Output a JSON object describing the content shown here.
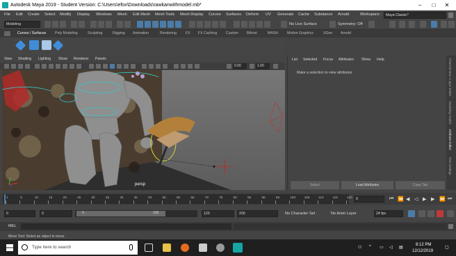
{
  "window": {
    "title": "Autodesk Maya 2019 - Student Version: C:\\Users\\efox\\Downloads\\rawkanwithmodel.mb*"
  },
  "menus": [
    "File",
    "Edit",
    "Create",
    "Select",
    "Modify",
    "Display",
    "Windows",
    "Mesh",
    "Edit Mesh",
    "Mesh Tools",
    "Mesh Display",
    "Curves",
    "Surfaces",
    "Deform",
    "UV",
    "Generate",
    "Cache",
    "Substance",
    "Arnold"
  ],
  "workspace": {
    "label": "Workspace :",
    "value": "Maya Classic*"
  },
  "status_line": {
    "mode": "Modeling",
    "live_surface": "No Live Surface",
    "symmetry": "Symmetry: Off"
  },
  "shelf_tabs": [
    "Curves / Surfaces",
    "Poly Modeling",
    "Sculpting",
    "Rigging",
    "Animation",
    "Rendering",
    "FX",
    "FX Caching",
    "Custom",
    "Bifrost",
    "MASH",
    "Motion Graphics",
    "XGen",
    "Arnold"
  ],
  "viewport": {
    "menus": [
      "View",
      "Shading",
      "Lighting",
      "Show",
      "Renderer",
      "Panels"
    ],
    "near": "0.00",
    "far": "1.00",
    "camera_label": "persp"
  },
  "attribute_editor": {
    "menus": [
      "List",
      "Selected",
      "Focus",
      "Attributes",
      "Show",
      "Help"
    ],
    "message": "Make a selection to view attributes",
    "buttons": [
      "Select",
      "Load Attributes",
      "Copy Tab"
    ]
  },
  "side_tabs": [
    "Channel Box / Layer Editor",
    "Modeling Toolkit",
    "Attribute Editor",
    "Tool Settings"
  ],
  "time_slider": {
    "ticks": [
      "1",
      "5",
      "10",
      "15",
      "20",
      "25",
      "30",
      "35",
      "40",
      "45",
      "50",
      "55",
      "60",
      "65",
      "70",
      "75",
      "80",
      "85",
      "90",
      "95",
      "100",
      "105",
      "110",
      "115",
      "120"
    ],
    "current_frame": "0"
  },
  "range_slider": {
    "start": "0",
    "inner_start": "0",
    "range_left": "0",
    "range_right": "120",
    "inner_end": "120",
    "end": "200",
    "character_set": "No Character Set",
    "anim_layer": "No Anim Layer",
    "fps": "24 fps"
  },
  "command_line": {
    "label": "MEL"
  },
  "help_line": {
    "text": "Move Tool: Select an object to move."
  },
  "taskbar": {
    "search_placeholder": "Type here to search",
    "time": "8:12 PM",
    "date": "12/12/2019"
  }
}
